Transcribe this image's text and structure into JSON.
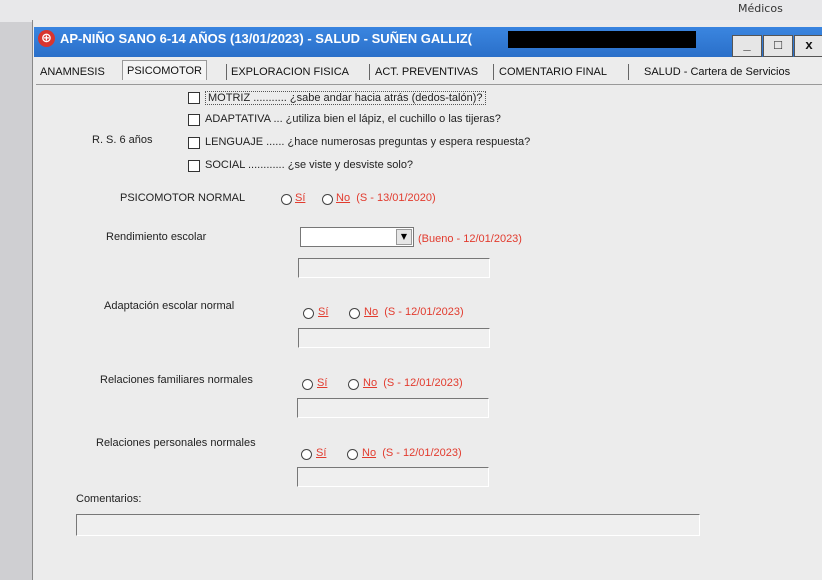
{
  "corner_label": "Médicos",
  "title": {
    "icon": "close-circle-icon",
    "text": "AP-NIÑO SANO 6-14 AÑOS (13/01/2023) - SALUD - SUÑEN GALLIZ("
  },
  "window_buttons": {
    "minimize": "_",
    "maximize": "□",
    "close": "x"
  },
  "tabs": [
    {
      "label": "ANAMNESIS"
    },
    {
      "label": "PSICOMOTOR"
    },
    {
      "label": "EXPLORACION FISICA"
    },
    {
      "label": "ACT. PREVENTIVAS"
    },
    {
      "label": "COMENTARIO FINAL"
    },
    {
      "label": "SALUD - Cartera de Servicios"
    }
  ],
  "rs": {
    "label": "R. S. 6 años",
    "items": [
      {
        "text": "MOTRIZ ........... ¿sabe andar hacia atrás (dedos-talón)?"
      },
      {
        "text": "ADAPTATIVA ... ¿utiliza bien el lápiz, el cuchillo o las tijeras?"
      },
      {
        "text": "LENGUAJE ...... ¿hace numerosas preguntas y espera respuesta?"
      },
      {
        "text": "SOCIAL ............ ¿se viste y desviste solo?"
      }
    ]
  },
  "psicomotor": {
    "label": "PSICOMOTOR NORMAL",
    "si": "Sí",
    "no": "No",
    "note": "(S - 13/01/2020)"
  },
  "rendimiento": {
    "label": "Rendimiento escolar",
    "note": "(Bueno - 12/01/2023)"
  },
  "adaptacion": {
    "label": "Adaptación escolar normal",
    "si": "Sí",
    "no": "No",
    "note": "(S - 12/01/2023)"
  },
  "familiares": {
    "label": "Relaciones familiares normales",
    "si": "Sí",
    "no": "No",
    "note": "(S - 12/01/2023)"
  },
  "personales": {
    "label": "Relaciones personales normales",
    "si": "Sí",
    "no": "No",
    "note": "(S - 12/01/2023)"
  },
  "comentarios": {
    "label": "Comentarios:"
  }
}
